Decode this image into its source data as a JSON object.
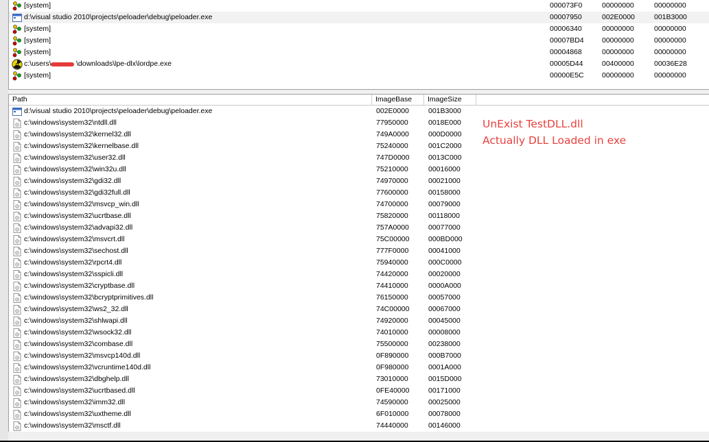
{
  "processes": [
    {
      "path": "[system]",
      "v1": "000073F0",
      "v2": "00000000",
      "v3": "00000000",
      "icon": "system-process-icon"
    },
    {
      "path": "d:\\visual studio 2010\\projects\\peloader\\debug\\peloader.exe",
      "v1": "00007950",
      "v2": "002E0000",
      "v3": "001B3000",
      "icon": "exe-window-icon"
    },
    {
      "path": "[system]",
      "v1": "00006340",
      "v2": "00000000",
      "v3": "00000000",
      "icon": "system-process-icon"
    },
    {
      "path": "[system]",
      "v1": "00007BD4",
      "v2": "00000000",
      "v3": "00000000",
      "icon": "system-process-icon"
    },
    {
      "path": "[system]",
      "v1": "00004868",
      "v2": "00000000",
      "v3": "00000000",
      "icon": "system-process-icon"
    },
    {
      "path": "c:\\users\\",
      "path_rest": "\\downloads\\lpe-dlx\\lordpe.exe",
      "v1": "00005D44",
      "v2": "00400000",
      "v3": "00036E28",
      "icon": "radiation-icon"
    },
    {
      "path": "[system]",
      "v1": "00000E5C",
      "v2": "00000000",
      "v3": "00000000",
      "icon": "system-process-icon"
    }
  ],
  "module_headers": {
    "path": "Path",
    "imagebase": "ImageBase",
    "imagesize": "ImageSize"
  },
  "modules": [
    {
      "path": "d:\\visual studio 2010\\projects\\peloader\\debug\\peloader.exe",
      "base": "002E0000",
      "size": "001B3000",
      "icon": "exe-window-icon"
    },
    {
      "path": "c:\\windows\\system32\\ntdll.dll",
      "base": "77950000",
      "size": "0018E000",
      "icon": "dll-file-icon"
    },
    {
      "path": "c:\\windows\\system32\\kernel32.dll",
      "base": "749A0000",
      "size": "000D0000",
      "icon": "dll-file-icon"
    },
    {
      "path": "c:\\windows\\system32\\kernelbase.dll",
      "base": "75240000",
      "size": "001C2000",
      "icon": "dll-file-icon"
    },
    {
      "path": "c:\\windows\\system32\\user32.dll",
      "base": "747D0000",
      "size": "0013C000",
      "icon": "dll-file-icon"
    },
    {
      "path": "c:\\windows\\system32\\win32u.dll",
      "base": "75210000",
      "size": "00016000",
      "icon": "dll-file-icon"
    },
    {
      "path": "c:\\windows\\system32\\gdi32.dll",
      "base": "74970000",
      "size": "00021000",
      "icon": "dll-file-icon"
    },
    {
      "path": "c:\\windows\\system32\\gdi32full.dll",
      "base": "77600000",
      "size": "00158000",
      "icon": "dll-file-icon"
    },
    {
      "path": "c:\\windows\\system32\\msvcp_win.dll",
      "base": "74700000",
      "size": "00079000",
      "icon": "dll-file-icon"
    },
    {
      "path": "c:\\windows\\system32\\ucrtbase.dll",
      "base": "75820000",
      "size": "00118000",
      "icon": "dll-file-icon"
    },
    {
      "path": "c:\\windows\\system32\\advapi32.dll",
      "base": "757A0000",
      "size": "00077000",
      "icon": "dll-file-icon"
    },
    {
      "path": "c:\\windows\\system32\\msvcrt.dll",
      "base": "75C00000",
      "size": "000BD000",
      "icon": "dll-file-icon"
    },
    {
      "path": "c:\\windows\\system32\\sechost.dll",
      "base": "777F0000",
      "size": "00041000",
      "icon": "dll-file-icon"
    },
    {
      "path": "c:\\windows\\system32\\rpcrt4.dll",
      "base": "75940000",
      "size": "000C0000",
      "icon": "dll-file-icon"
    },
    {
      "path": "c:\\windows\\system32\\sspicli.dll",
      "base": "74420000",
      "size": "00020000",
      "icon": "dll-file-icon"
    },
    {
      "path": "c:\\windows\\system32\\cryptbase.dll",
      "base": "74410000",
      "size": "0000A000",
      "icon": "dll-file-icon"
    },
    {
      "path": "c:\\windows\\system32\\bcryptprimitives.dll",
      "base": "76150000",
      "size": "00057000",
      "icon": "dll-file-icon"
    },
    {
      "path": "c:\\windows\\system32\\ws2_32.dll",
      "base": "74C00000",
      "size": "00067000",
      "icon": "dll-file-icon"
    },
    {
      "path": "c:\\windows\\system32\\shlwapi.dll",
      "base": "74920000",
      "size": "00045000",
      "icon": "dll-file-icon"
    },
    {
      "path": "c:\\windows\\system32\\wsock32.dll",
      "base": "74010000",
      "size": "00008000",
      "icon": "dll-file-icon"
    },
    {
      "path": "c:\\windows\\system32\\combase.dll",
      "base": "75500000",
      "size": "00238000",
      "icon": "dll-file-icon"
    },
    {
      "path": "c:\\windows\\system32\\msvcp140d.dll",
      "base": "0F890000",
      "size": "000B7000",
      "icon": "dll-file-icon"
    },
    {
      "path": "c:\\windows\\system32\\vcruntime140d.dll",
      "base": "0F980000",
      "size": "0001A000",
      "icon": "dll-file-icon"
    },
    {
      "path": "c:\\windows\\system32\\dbghelp.dll",
      "base": "73010000",
      "size": "0015D000",
      "icon": "dll-file-icon"
    },
    {
      "path": "c:\\windows\\system32\\ucrtbased.dll",
      "base": "0FE40000",
      "size": "00171000",
      "icon": "dll-file-icon"
    },
    {
      "path": "c:\\windows\\system32\\imm32.dll",
      "base": "74590000",
      "size": "00025000",
      "icon": "dll-file-icon"
    },
    {
      "path": "c:\\windows\\system32\\uxtheme.dll",
      "base": "6F010000",
      "size": "00078000",
      "icon": "dll-file-icon"
    },
    {
      "path": "c:\\windows\\system32\\msctf.dll",
      "base": "74440000",
      "size": "00146000",
      "icon": "dll-file-icon"
    }
  ],
  "annotation": {
    "line1": "UnExist TestDLL.dll",
    "line2": "Actually DLL Loaded in exe",
    "color": "#e8413e"
  }
}
